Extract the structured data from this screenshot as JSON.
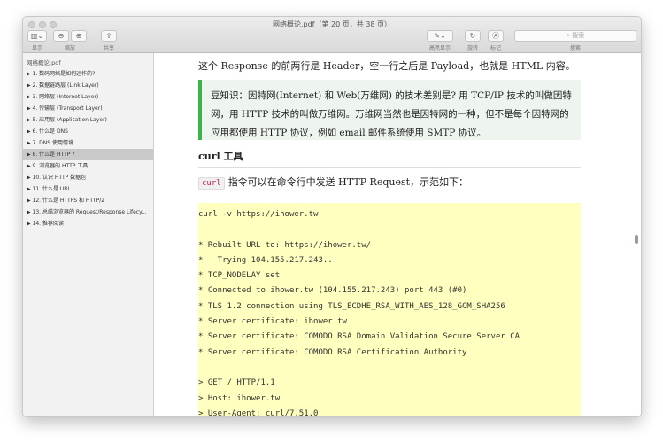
{
  "window": {
    "title": "网络概论.pdf（第 20 页，共 38 页）"
  },
  "toolbar": {
    "display": "显示",
    "zoom": "缩放",
    "share": "共享",
    "highlight": "高亮显示",
    "rotate": "旋转",
    "markup": "标记",
    "search_placeholder": "搜索",
    "search_label": "搜索"
  },
  "sidebar": {
    "file": "网络概论.pdf",
    "items": [
      {
        "label": "▶ 1. 数码网络是如何运作的?"
      },
      {
        "label": "▶ 2. 数据链路层 (Link Layer)"
      },
      {
        "label": "▶ 3. 网络层 (Internet Layer)"
      },
      {
        "label": "▶ 4. 传输层 (Transport Layer)"
      },
      {
        "label": "▶ 5. 应用层 (Application Layer)"
      },
      {
        "label": "▶ 6. 什么是 DNS"
      },
      {
        "label": "▶ 7. DNS 使用情境"
      },
      {
        "label": "▶ 8. 什么是 HTTP ?"
      },
      {
        "label": "▶ 9. 浏览器的 HTTP 工具"
      },
      {
        "label": "▶ 10. 认识 HTTP 数据包"
      },
      {
        "label": "▶ 11. 什么是 URL"
      },
      {
        "label": "▶ 12. 什么是 HTTPS 和 HTTP/2"
      },
      {
        "label": "▶ 13. 总结浏览器的 Request/Response Lifecy..."
      },
      {
        "label": "▶ 14. 推荐阅读"
      }
    ]
  },
  "content": {
    "p1": "这个 Response 的前两行是 Header，空一行之后是 Payload，也就是 HTML 内容。",
    "quote": "豆知识：因特网(Internet) 和 Web(万维网) 的技术差别是? 用 TCP/IP 技术的叫做因特网，用 HTTP 技术的叫做万维网。万维网当然也是因特网的一种，但不是每个因特网的应用都使用 HTTP 协议，例如 email 邮件系统使用 SMTP 协议。",
    "heading": "curl 工具",
    "inline_code": "curl",
    "p2": "指令可以在命令行中发送 HTTP Request，示范如下：",
    "code_lines": [
      "curl -v https://ihower.tw",
      "",
      "* Rebuilt URL to: https://ihower.tw/",
      "*   Trying 104.155.217.243...",
      "* TCP_NODELAY set",
      "* Connected to ihower.tw (104.155.217.243) port 443 (#0)",
      "* TLS 1.2 connection using TLS_ECDHE_RSA_WITH_AES_128_GCM_SHA256",
      "* Server certificate: ihower.tw",
      "* Server certificate: COMODO RSA Domain Validation Secure Server CA",
      "* Server certificate: COMODO RSA Certification Authority",
      "",
      "> GET / HTTP/1.1",
      "> Host: ihower.tw",
      "> User-Agent: curl/7.51.0"
    ]
  }
}
